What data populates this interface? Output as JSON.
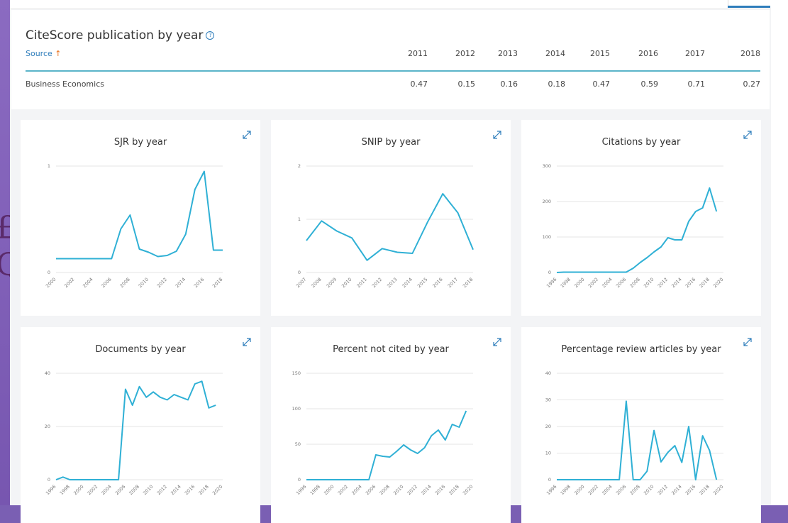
{
  "citescore": {
    "title": "CiteScore publication by year",
    "source_label": "Source",
    "source_arrow": "↑",
    "help_glyph": "?",
    "years": [
      "2011",
      "2012",
      "2013",
      "2014",
      "2015",
      "2016",
      "2017",
      "2018"
    ],
    "row_name": "Business Economics",
    "values": [
      "0.47",
      "0.15",
      "0.16",
      "0.18",
      "0.47",
      "0.59",
      "0.71",
      "0.27"
    ]
  },
  "colors": {
    "line": "#2fb0d5",
    "accent": "#2e7dbb",
    "sort_arrow": "#e9711c"
  },
  "chart_data": [
    {
      "type": "line",
      "title": "SJR by year",
      "x": [
        2000,
        2001,
        2002,
        2003,
        2004,
        2005,
        2006,
        2007,
        2008,
        2009,
        2010,
        2011,
        2012,
        2013,
        2014,
        2015,
        2016,
        2017,
        2018
      ],
      "y": [
        0.13,
        0.13,
        0.13,
        0.13,
        0.13,
        0.13,
        0.13,
        0.41,
        0.54,
        0.22,
        0.19,
        0.15,
        0.16,
        0.2,
        0.36,
        0.78,
        0.95,
        0.21,
        0.21
      ],
      "xticks": [
        "2000",
        "2002",
        "2004",
        "2006",
        "2008",
        "2010",
        "2012",
        "2014",
        "2016",
        "2018"
      ],
      "yticks": [
        "0",
        "1"
      ],
      "ylim": [
        0,
        1
      ]
    },
    {
      "type": "line",
      "title": "SNIP by year",
      "x": [
        2007,
        2008,
        2009,
        2010,
        2011,
        2012,
        2013,
        2014,
        2015,
        2016,
        2017,
        2018
      ],
      "y": [
        0.6,
        0.97,
        0.78,
        0.65,
        0.23,
        0.45,
        0.38,
        0.36,
        0.95,
        1.48,
        1.12,
        0.43
      ],
      "xticks": [
        "2007",
        "2008",
        "2009",
        "2010",
        "2011",
        "2012",
        "2013",
        "2014",
        "2015",
        "2016",
        "2017",
        "2018"
      ],
      "yticks": [
        "0",
        "1",
        "2"
      ],
      "ylim": [
        0,
        2
      ]
    },
    {
      "type": "line",
      "title": "Citations by year",
      "x": [
        1996,
        1997,
        1998,
        1999,
        2000,
        2001,
        2002,
        2003,
        2004,
        2005,
        2006,
        2007,
        2008,
        2009,
        2010,
        2011,
        2012,
        2013,
        2014,
        2015,
        2016,
        2017,
        2018,
        2019
      ],
      "y": [
        0,
        1,
        1,
        1,
        1,
        1,
        1,
        1,
        1,
        1,
        1,
        12,
        28,
        42,
        58,
        72,
        98,
        92,
        92,
        144,
        172,
        182,
        238,
        172
      ],
      "xticks": [
        "1996",
        "1998",
        "2000",
        "2002",
        "2004",
        "2006",
        "2008",
        "2010",
        "2012",
        "2014",
        "2016",
        "2018",
        "2020"
      ],
      "yticks": [
        "0",
        "100",
        "200",
        "300"
      ],
      "ylim": [
        0,
        300
      ]
    },
    {
      "type": "line",
      "title": "Documents by year",
      "x": [
        1996,
        1997,
        1998,
        1999,
        2000,
        2001,
        2002,
        2003,
        2004,
        2005,
        2006,
        2007,
        2008,
        2009,
        2010,
        2011,
        2012,
        2013,
        2014,
        2015,
        2016,
        2017,
        2018,
        2019
      ],
      "y": [
        0,
        1,
        0,
        0,
        0,
        0,
        0,
        0,
        0,
        0,
        34,
        28,
        35,
        31,
        33,
        31,
        30,
        32,
        31,
        30,
        36,
        37,
        27,
        28
      ],
      "xticks": [
        "1996",
        "1998",
        "2000",
        "2002",
        "2004",
        "2006",
        "2008",
        "2010",
        "2012",
        "2014",
        "2016",
        "2018",
        "2020"
      ],
      "yticks": [
        "0",
        "20",
        "40"
      ],
      "ylim": [
        0,
        40
      ]
    },
    {
      "type": "line",
      "title": "Percent not cited by year",
      "x": [
        1996,
        1997,
        1998,
        1999,
        2000,
        2001,
        2002,
        2003,
        2004,
        2005,
        2006,
        2007,
        2008,
        2009,
        2010,
        2011,
        2012,
        2013,
        2014,
        2015,
        2016,
        2017,
        2018,
        2019
      ],
      "y": [
        0,
        0,
        0,
        0,
        0,
        0,
        0,
        0,
        0,
        0,
        35,
        33,
        32,
        40,
        49,
        42,
        37,
        45,
        62,
        70,
        56,
        78,
        74,
        97
      ],
      "xticks": [
        "1996",
        "1998",
        "2000",
        "2002",
        "2004",
        "2006",
        "2008",
        "2010",
        "2012",
        "2014",
        "2016",
        "2018",
        "2020"
      ],
      "yticks": [
        "0",
        "50",
        "100",
        "150"
      ],
      "ylim": [
        0,
        150
      ]
    },
    {
      "type": "line",
      "title": "Percentage review articles by year",
      "x": [
        1996,
        1997,
        1998,
        1999,
        2000,
        2001,
        2002,
        2003,
        2004,
        2005,
        2006,
        2007,
        2008,
        2009,
        2010,
        2011,
        2012,
        2013,
        2014,
        2015,
        2016,
        2017,
        2018,
        2019
      ],
      "y": [
        0,
        0,
        0,
        0,
        0,
        0,
        0,
        0,
        0,
        0,
        29.5,
        0,
        0,
        3.2,
        18.5,
        6.7,
        10.3,
        12.8,
        6.5,
        20,
        0,
        16.5,
        11,
        0
      ],
      "xticks": [
        "1996",
        "1998",
        "2000",
        "2002",
        "2004",
        "2006",
        "2008",
        "2010",
        "2012",
        "2014",
        "2016",
        "2018",
        "2020"
      ],
      "yticks": [
        "0",
        "10",
        "20",
        "30",
        "40"
      ],
      "ylim": [
        0,
        40
      ]
    }
  ]
}
